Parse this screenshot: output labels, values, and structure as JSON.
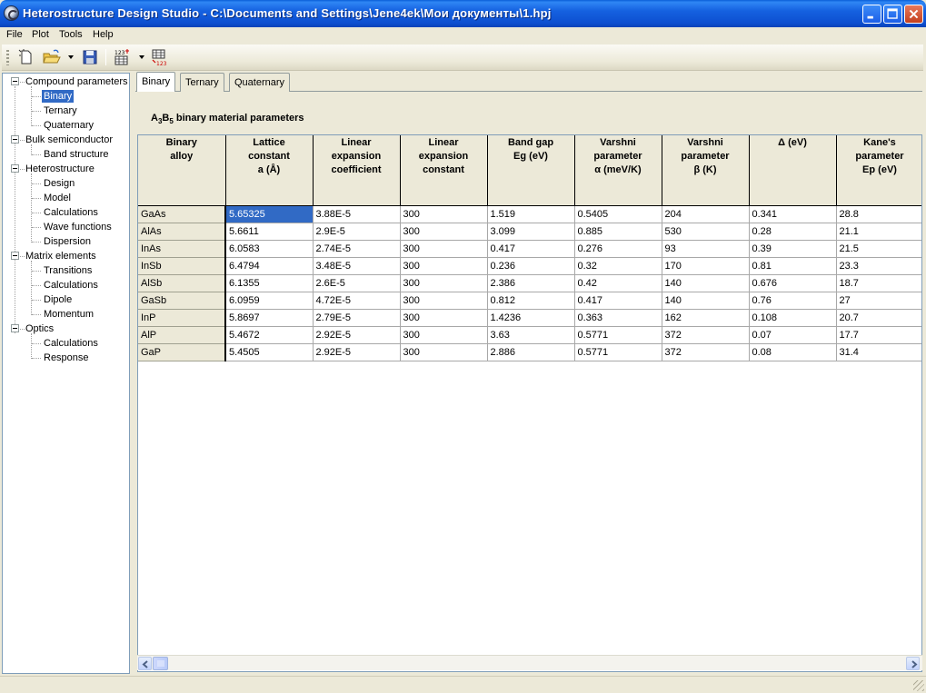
{
  "window": {
    "title": "Heterostructure Design Studio - C:\\Documents and Settings\\Jene4ek\\Мои документы\\1.hpj"
  },
  "menu": [
    "File",
    "Plot",
    "Tools",
    "Help"
  ],
  "toolbar": {
    "icons": [
      "new-file-icon",
      "open-folder-icon",
      "save-icon",
      "table-numbers-icon",
      "table-export-icon"
    ]
  },
  "tree": {
    "groups": [
      {
        "label": "Compound parameters",
        "children": [
          "Binary",
          "Ternary",
          "Quaternary"
        ]
      },
      {
        "label": "Bulk semiconductor",
        "children": [
          "Band structure"
        ]
      },
      {
        "label": "Heterostructure",
        "children": [
          "Design",
          "Model",
          "Calculations",
          "Wave functions",
          "Dispersion"
        ]
      },
      {
        "label": "Matrix elements",
        "children": [
          "Transitions",
          "Calculations",
          "Dipole",
          "Momentum"
        ]
      },
      {
        "label": "Optics",
        "children": [
          "Calculations",
          "Response"
        ]
      }
    ],
    "selected": "Binary"
  },
  "tabs": [
    "Binary",
    "Ternary",
    "Quaternary"
  ],
  "active_tab": "Binary",
  "section": {
    "title_a": "A",
    "title_a_sub": "3",
    "title_b": "B",
    "title_b_sub": "5",
    "title_rest": " binary material parameters"
  },
  "table": {
    "headers": [
      [
        "Binary",
        "alloy"
      ],
      [
        "Lattice",
        "constant",
        "a (Å)"
      ],
      [
        "Linear",
        "expansion",
        "coefficient"
      ],
      [
        "Linear",
        "expansion",
        "constant"
      ],
      [
        "Band gap",
        "Eg (eV)"
      ],
      [
        "Varshni",
        "parameter",
        "α (meV/K)"
      ],
      [
        "Varshni",
        "parameter",
        "β (K)"
      ],
      [
        "Δ (eV)"
      ],
      [
        "Kane's",
        "parameter",
        "Ep (eV)"
      ]
    ],
    "rows": [
      [
        "GaAs",
        "5.65325",
        "3.88E-5",
        "300",
        "1.519",
        "0.5405",
        "204",
        "0.341",
        "28.8"
      ],
      [
        "AlAs",
        "5.6611",
        "2.9E-5",
        "300",
        "3.099",
        "0.885",
        "530",
        "0.28",
        "21.1"
      ],
      [
        "InAs",
        "6.0583",
        "2.74E-5",
        "300",
        "0.417",
        "0.276",
        "93",
        "0.39",
        "21.5"
      ],
      [
        "InSb",
        "6.4794",
        "3.48E-5",
        "300",
        "0.236",
        "0.32",
        "170",
        "0.81",
        "23.3"
      ],
      [
        "AlSb",
        "6.1355",
        "2.6E-5",
        "300",
        "2.386",
        "0.42",
        "140",
        "0.676",
        "18.7"
      ],
      [
        "GaSb",
        "6.0959",
        "4.72E-5",
        "300",
        "0.812",
        "0.417",
        "140",
        "0.76",
        "27"
      ],
      [
        "InP",
        "5.8697",
        "2.79E-5",
        "300",
        "1.4236",
        "0.363",
        "162",
        "0.108",
        "20.7"
      ],
      [
        "AlP",
        "5.4672",
        "2.92E-5",
        "300",
        "3.63",
        "0.5771",
        "372",
        "0.07",
        "17.7"
      ],
      [
        "GaP",
        "5.4505",
        "2.92E-5",
        "300",
        "2.886",
        "0.5771",
        "372",
        "0.08",
        "31.4"
      ]
    ],
    "selected_cell": [
      0,
      1
    ]
  },
  "colors": {
    "titlebar": "#0d4fd0",
    "selection": "#316ac5",
    "face": "#ece9d8"
  }
}
